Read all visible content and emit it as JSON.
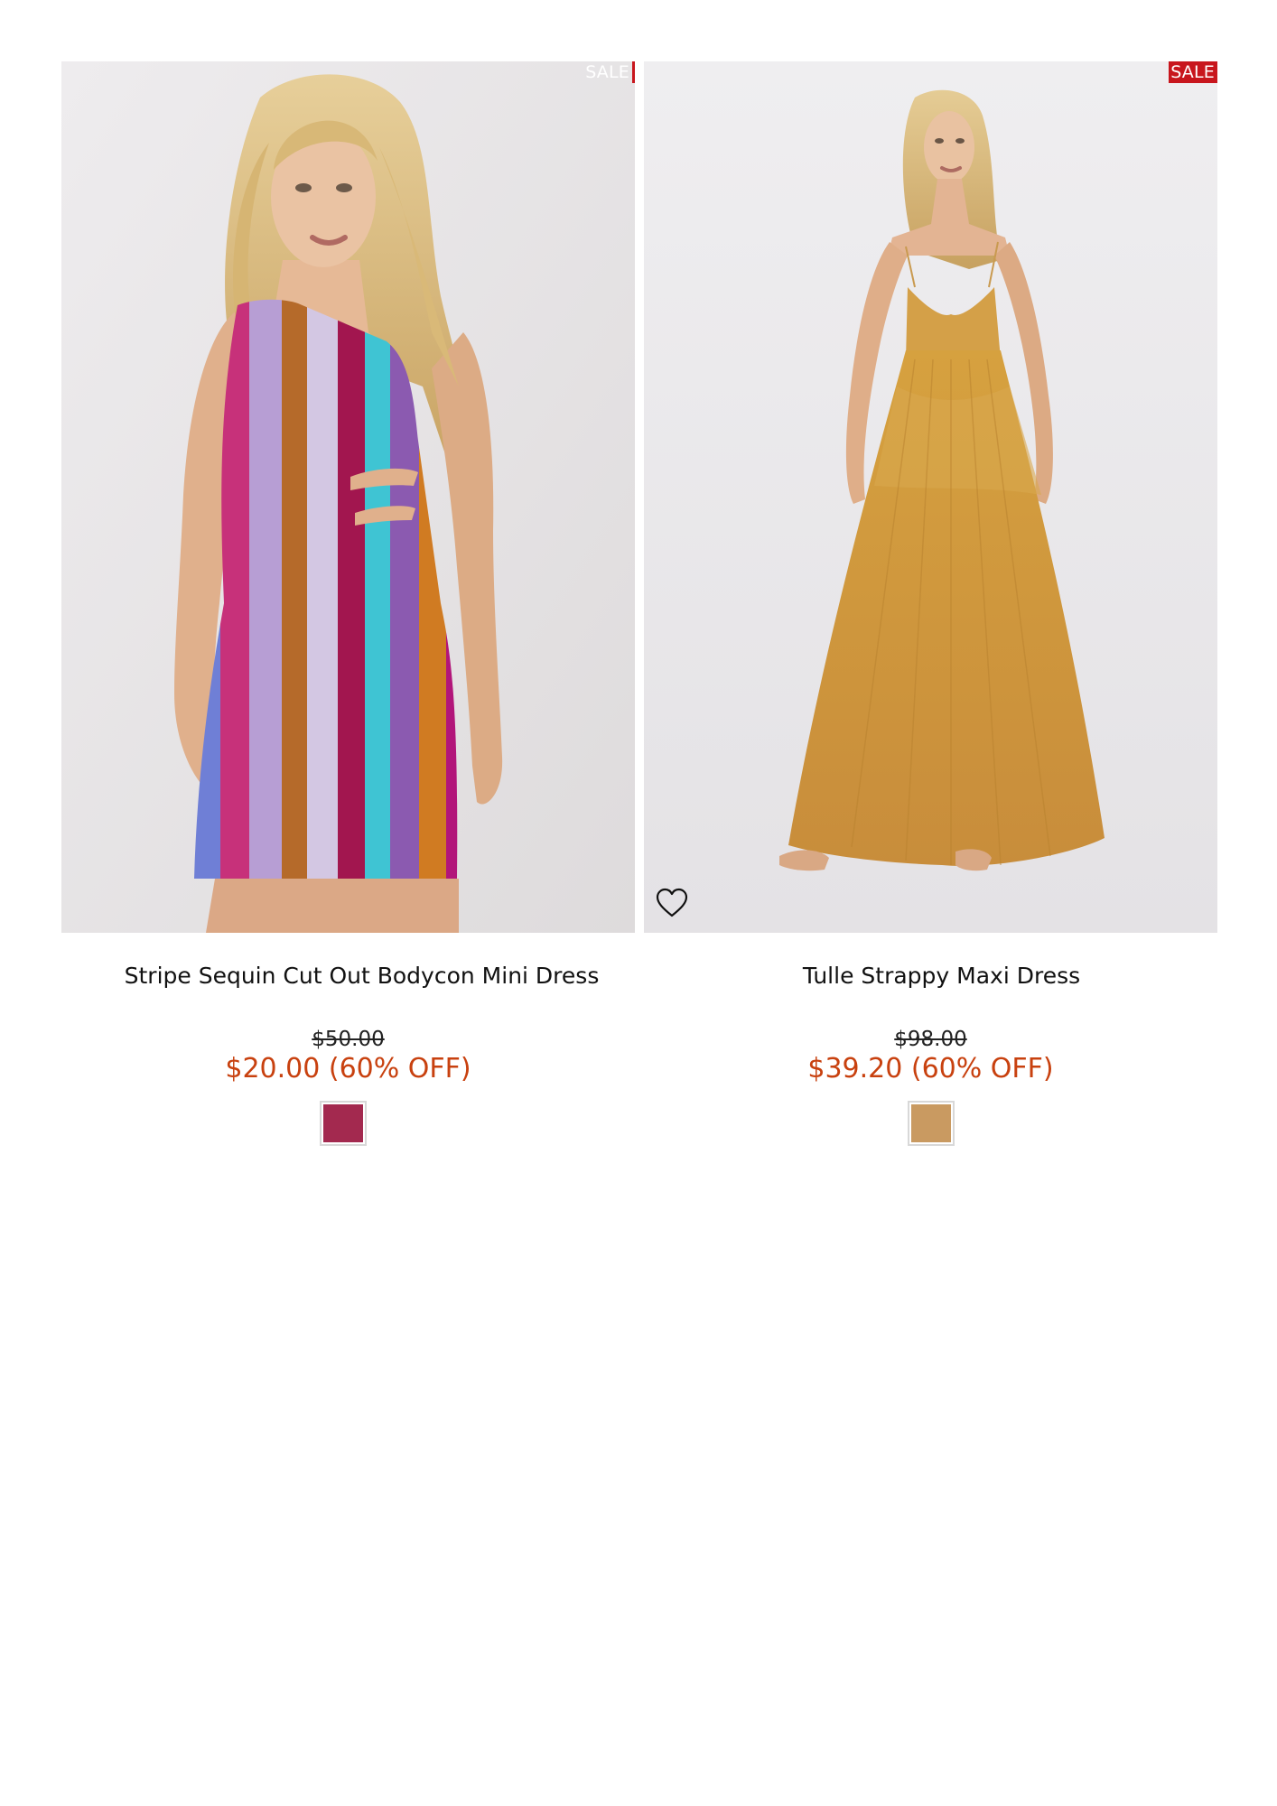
{
  "products": [
    {
      "badge": "SALE",
      "title": "Stripe Sequin Cut Out Bodycon Mini Dress",
      "original_price": "$50.00",
      "sale_price": "$20.00 (60% OFF)",
      "swatch_color": "#a3294f",
      "image_alt": "Model wearing multicolor stripe sequin one-shoulder mini dress"
    },
    {
      "badge": "SALE",
      "title": "Tulle Strappy Maxi Dress",
      "original_price": "$98.00",
      "sale_price": "$39.20 (60% OFF)",
      "swatch_color": "#c99a61",
      "image_alt": "Model wearing mustard tulle strappy maxi dress",
      "wishlist_icon": "heart-outline-icon"
    }
  ],
  "colors": {
    "sale_badge": "#c8161d",
    "sale_price": "#c8410f"
  }
}
